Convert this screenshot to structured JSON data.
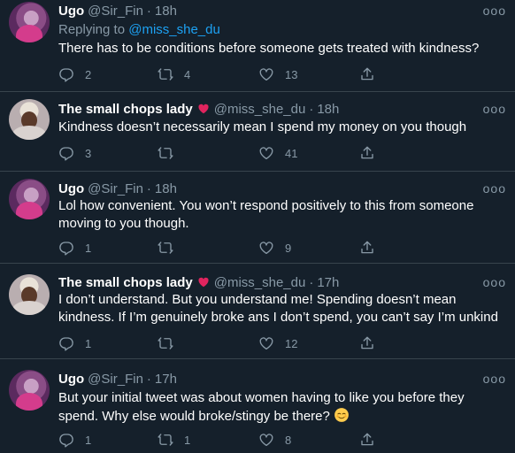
{
  "tweets": [
    {
      "author": "Ugo",
      "handle": "@Sir_Fin",
      "time": "18h",
      "reply_prefix": "Replying to ",
      "reply_mention": "@miss_she_du",
      "text": "There has to be conditions before someone gets treated with kindness?",
      "replies": "2",
      "retweets": "4",
      "likes": "13",
      "avatar": "ugo"
    },
    {
      "author": "The small chops lady",
      "author_emoji": "heart",
      "handle": "@miss_she_du",
      "time": "18h",
      "text": "Kindness doesn’t necessarily mean I spend my money on you though",
      "replies": "3",
      "retweets": "",
      "likes": "41",
      "avatar": "lady"
    },
    {
      "author": "Ugo",
      "handle": "@Sir_Fin",
      "time": "18h",
      "text": "Lol how convenient. You won’t respond positively to this from someone moving to you though.",
      "replies": "1",
      "retweets": "",
      "likes": "9",
      "avatar": "ugo"
    },
    {
      "author": "The small chops lady",
      "author_emoji": "heart",
      "handle": "@miss_she_du",
      "time": "17h",
      "text": "I don’t understand. But you understand me! Spending doesn’t mean kindness. If I’m genuinely broke ans I don’t spend, you can’t say I’m unkind",
      "replies": "1",
      "retweets": "",
      "likes": "12",
      "avatar": "lady"
    },
    {
      "author": "Ugo",
      "handle": "@Sir_Fin",
      "time": "17h",
      "text": "But your initial tweet was about women having to like you before they spend. Why else would broke/stingy be there?",
      "text_emoji": "relieved-face",
      "replies": "1",
      "retweets": "1",
      "likes": "8",
      "avatar": "ugo"
    }
  ],
  "separator": "·",
  "more_glyph": "ooo",
  "colors": {
    "background": "#15202b",
    "secondary": "#8899a6",
    "link": "#1da1f2",
    "heart": "#e0245e",
    "divider": "#38444d"
  }
}
